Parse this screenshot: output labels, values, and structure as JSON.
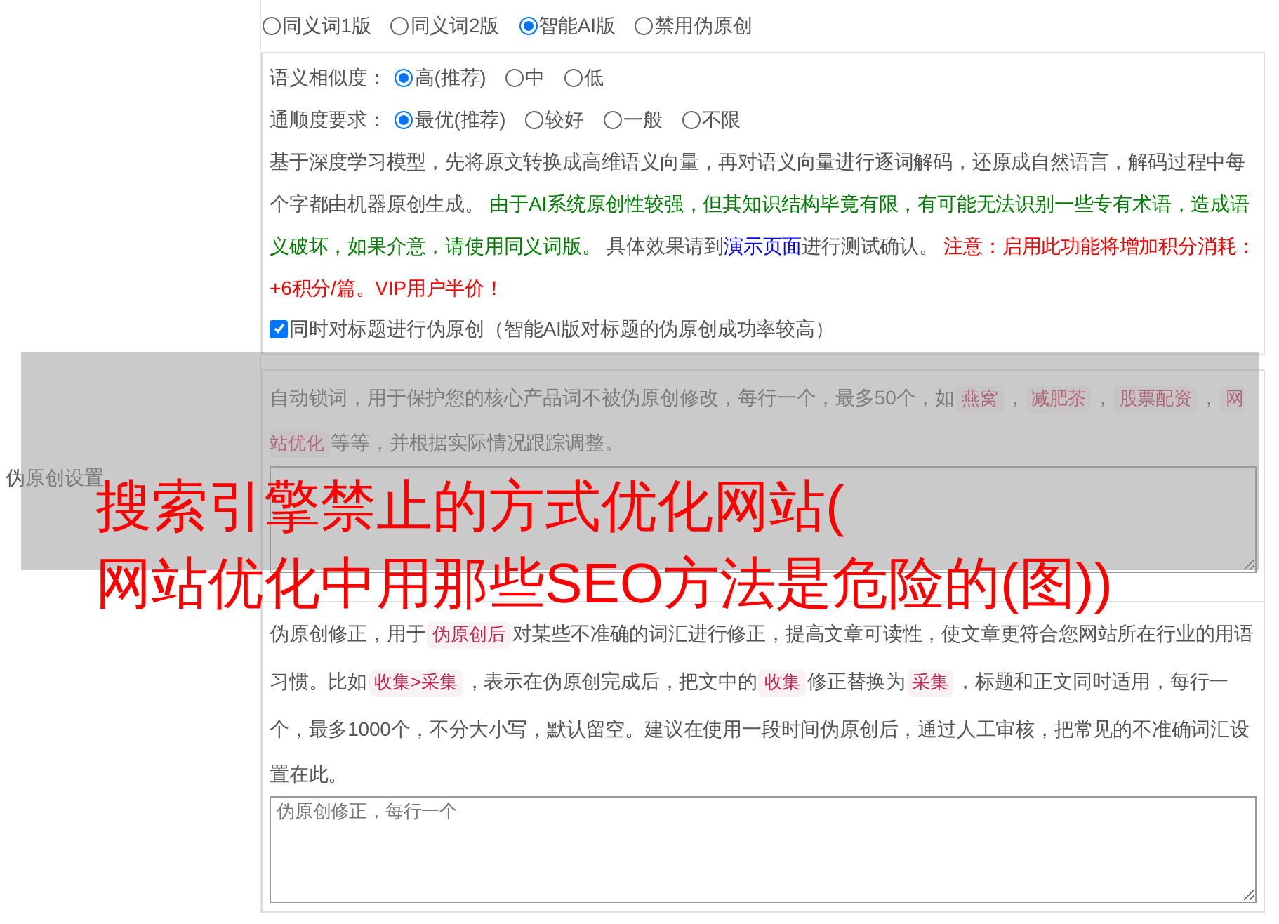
{
  "section_label": "伪原创设置",
  "versions": [
    {
      "label": "同义词1版",
      "selected": false
    },
    {
      "label": "同义词2版",
      "selected": false
    },
    {
      "label": "智能AI版",
      "selected": true
    },
    {
      "label": "禁用伪原创",
      "selected": false
    }
  ],
  "option_groups": [
    {
      "label": "语义相似度：",
      "options": [
        {
          "label": "高(推荐)",
          "selected": true
        },
        {
          "label": "中",
          "selected": false
        },
        {
          "label": "低",
          "selected": false
        }
      ]
    },
    {
      "label": "通顺度要求：",
      "options": [
        {
          "label": "最优(推荐)",
          "selected": true
        },
        {
          "label": "较好",
          "selected": false
        },
        {
          "label": "一般",
          "selected": false
        },
        {
          "label": "不限",
          "selected": false
        }
      ]
    }
  ],
  "ai_description": [
    {
      "kind": "text",
      "text": "基于深度学习模型，先将原文转换成高维语义向量，再对语义向量进行逐词解码，还原成自然语言，解码过程中每个字都由机器原创生成。 "
    },
    {
      "kind": "green",
      "text": "由于AI系统原创性较强，但其知识结构毕竟有限，有可能无法识别一些专有术语，造成语义破坏，如果介意，请使用同义词版。"
    },
    {
      "kind": "text",
      "text": " 具体效果请到"
    },
    {
      "kind": "link",
      "text": "演示页面"
    },
    {
      "kind": "text",
      "text": "进行测试确认。 "
    },
    {
      "kind": "red",
      "text": "注意：启用此功能将增加积分消耗：+6积分/篇。VIP用户半价！"
    }
  ],
  "title_option": {
    "label": "同时对标题进行伪原创（智能AI版对标题的伪原创成功率较高）",
    "checked": true
  },
  "lock_description": [
    {
      "kind": "text",
      "text": "自动锁词，用于保护您的核心产品词不被伪原创修改，每行一个，最多50个，如"
    },
    {
      "kind": "code",
      "text": "燕窝"
    },
    {
      "kind": "text",
      "text": "，"
    },
    {
      "kind": "code",
      "text": "减肥茶"
    },
    {
      "kind": "text",
      "text": "，"
    },
    {
      "kind": "code",
      "text": "股票配资"
    },
    {
      "kind": "text",
      "text": "，"
    },
    {
      "kind": "code",
      "text": "网站优化"
    },
    {
      "kind": "text",
      "text": "等等，并根据实际情况跟踪调整。"
    }
  ],
  "correction_description": [
    {
      "kind": "text",
      "text": "伪原创修正，用于"
    },
    {
      "kind": "code",
      "text": "伪原创后"
    },
    {
      "kind": "text",
      "text": "对某些不准确的词汇进行修正，提高文章可读性，使文章更符合您网站所在行业的用语习惯。比如"
    },
    {
      "kind": "code",
      "text": "收集>采集"
    },
    {
      "kind": "text",
      "text": "，表示在伪原创完成后，把文中的"
    },
    {
      "kind": "code",
      "text": "收集"
    },
    {
      "kind": "text",
      "text": "修正替换为"
    },
    {
      "kind": "code",
      "text": "采集"
    },
    {
      "kind": "text",
      "text": "，标题和正文同时适用，每行一个，最多1000个，不分大小写，默认留空。建议在使用一段时间伪原创后，通过人工审核，把常见的不准确词汇设置在此。"
    }
  ],
  "correction_field": {
    "placeholder": "伪原创修正，每行一个"
  },
  "overlay_title": [
    "搜索引擎禁止的方式优化网站(",
    "网站优化中用那些SEO方法是危险的(图))"
  ]
}
